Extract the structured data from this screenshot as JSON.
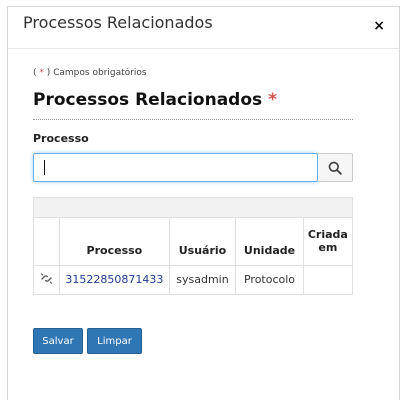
{
  "modal": {
    "title": "Processos Relacionados",
    "close_icon": "×"
  },
  "form": {
    "required_prefix": "( ",
    "required_asterisk": "*",
    "required_suffix": " ) Campos obrigatórios",
    "section_title": "Processos Relacionados",
    "section_required_mark": "*",
    "processo_label": "Processo",
    "processo_value": "",
    "search_icon": "search-icon"
  },
  "table": {
    "columns": [
      "",
      "Processo",
      "Usuário",
      "Unidade",
      "Criada em"
    ],
    "rows": [
      {
        "icon": "unlink-icon",
        "processo": "31522850871433",
        "usuario": "sysadmin",
        "unidade": "Protocolo",
        "criada_em": ""
      }
    ]
  },
  "buttons": {
    "salvar": "Salvar",
    "limpar": "Limpar"
  },
  "colors": {
    "primary": "#2e76b4",
    "required": "#d9534f",
    "link": "#1f3a93",
    "focus": "#66afe9"
  }
}
